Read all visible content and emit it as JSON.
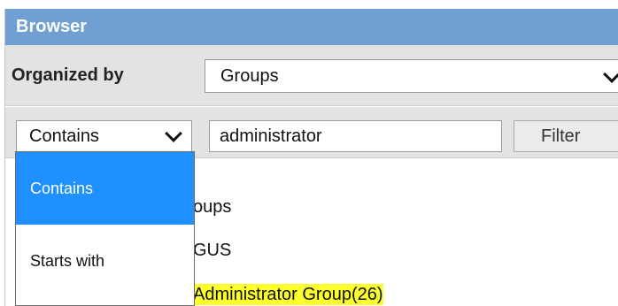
{
  "window": {
    "title": "Browser"
  },
  "organize": {
    "label": "Organized by",
    "selected": "Groups"
  },
  "filter": {
    "mode_selected": "Contains",
    "search_value": "administrator",
    "button_label": "Filter",
    "mode_options": [
      "Contains",
      "Starts with"
    ]
  },
  "tree": {
    "items": [
      {
        "text": "oups"
      },
      {
        "text": "GUS"
      },
      {
        "text": "Administrator Group(26)"
      }
    ]
  },
  "colors": {
    "titlebar": "#6f9fd3",
    "selected_option": "#1e90ff",
    "highlight": "#fcff2c"
  }
}
